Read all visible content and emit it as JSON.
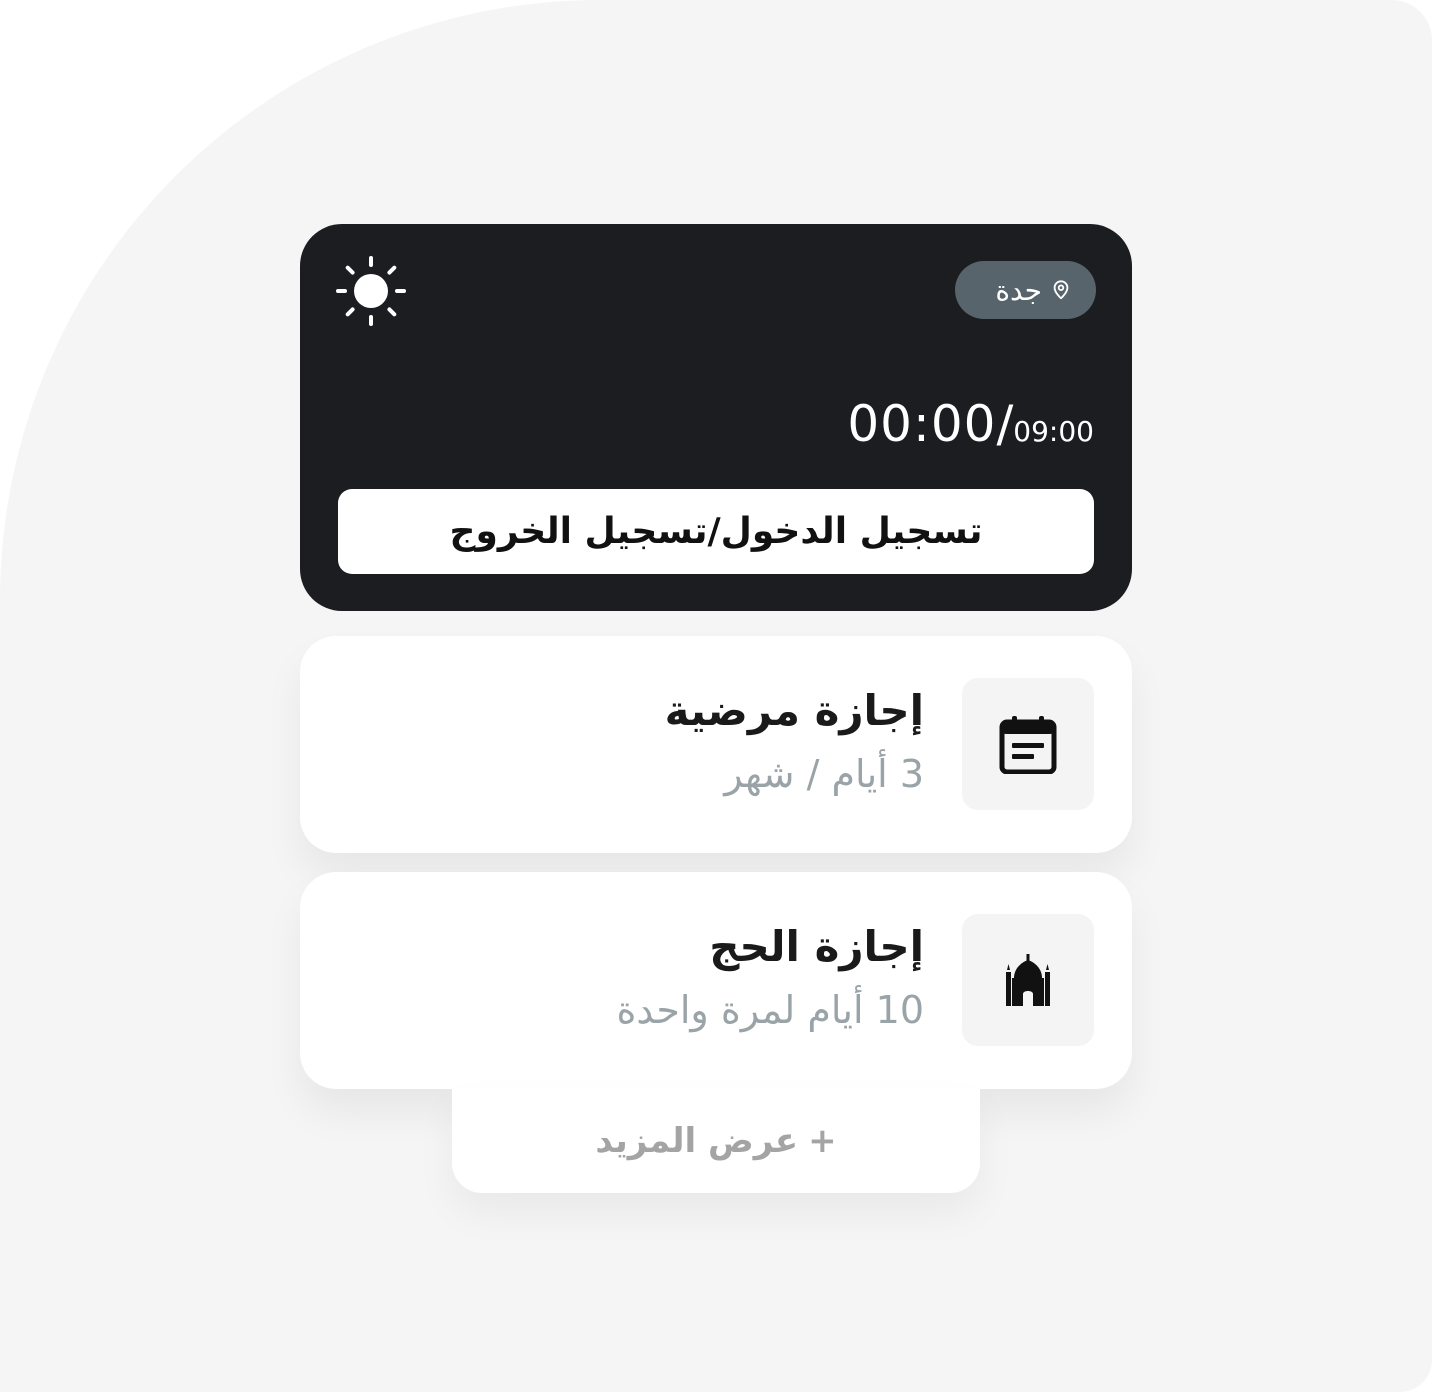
{
  "attendance": {
    "location": "جدة",
    "time_elapsed": "00:00",
    "time_separator": "/",
    "time_target": "09:00",
    "checkin_label": "تسجيل الدخول/تسجيل الخروج",
    "icons": {
      "location": "location-pin-icon",
      "weather": "sun-icon"
    }
  },
  "leaves": [
    {
      "title": "إجازة مرضية",
      "subtitle": "3 أيام / شهر",
      "icon": "calendar-icon"
    },
    {
      "title": "إجازة الحج",
      "subtitle": "10 أيام لمرة واحدة",
      "icon": "mosque-icon"
    }
  ],
  "show_more": {
    "plus": "+",
    "label": "عرض المزيد"
  },
  "colors": {
    "card_dark": "#1c1d20",
    "pill": "#58646b",
    "muted_text": "#9aa4a8",
    "background": "#f5f5f5"
  }
}
